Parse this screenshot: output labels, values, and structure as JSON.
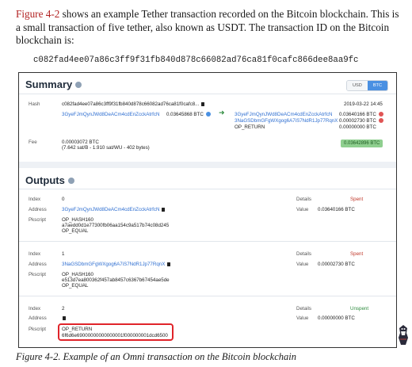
{
  "intro": {
    "xref": "Figure 4-2",
    "text": " shows an example Tether transaction recorded on the Bitcoin blockchain. This is a small transaction of five tether, also known as USDT. The transaction ID on the Bitcoin blockchain is:"
  },
  "txid": "c082fad4ee07a86c3ff9f31fb840d878c66082ad76ca81f0cafc866dee8aa9fc",
  "summary": {
    "title": "Summary",
    "toggle": [
      "USD",
      "BTC"
    ],
    "active_unit": "BTC",
    "hash_label": "Hash",
    "hash_value": "c082fad4ee07a86c3ff9f31fb840d878c66082ad76ca81f0cafc8...",
    "timestamp": "2019-03-22 14:45",
    "input": {
      "address": "3GyeFJmQynJWd8DeACm4cdEnZcckAtrfcN",
      "amount": "0.03645868 BTC"
    },
    "outputs": [
      {
        "address": "3GyeFJmQynJWd8DeACm4cdEnZcckAtrfcN",
        "amount": "0.03640166 BTC"
      },
      {
        "address": "3NaGSDbmGFgWXgog6A7iS7NdR1Jp77RqnX",
        "amount": "0.00002730 BTC"
      },
      {
        "address": "OP_RETURN",
        "amount": "0.00000000 BTC"
      }
    ],
    "fee_label": "Fee",
    "fee_value": "0.00003072 BTC",
    "fee_detail": "(7.642 sat/B - 1.910 sat/WU - 402 bytes)",
    "total": "0.03642896 BTC"
  },
  "outputs_section": {
    "title": "Outputs",
    "labels": {
      "index": "Index",
      "address": "Address",
      "pkscript": "Pkscript",
      "details": "Details",
      "value": "Value"
    },
    "items": [
      {
        "index": "0",
        "address": "3GyeFJmQynJWd8DeACm4cdEnZcckAtrfcN",
        "pkscript": [
          "OP_HASH160",
          "a7aedd0d1e77300fb06aa154c9a517b74c08d245",
          "OP_EQUAL"
        ],
        "status": "Spent",
        "value": "0.03640166 BTC"
      },
      {
        "index": "1",
        "address": "3NaGSDbmGFgWXgog6A7iS7NdR1Jp77RqnX",
        "pkscript": [
          "OP_HASH160",
          "e513d7ea800362f457ab8457c6367b67454ae5de",
          "OP_EQUAL"
        ],
        "status": "Spent",
        "value": "0.00002730 BTC"
      },
      {
        "index": "2",
        "address": "",
        "pkscript": [
          "OP_RETURN",
          "6f6d6e69000000000000001f000000001dcd6500"
        ],
        "status": "Unspent",
        "value": "0.00000000 BTC"
      }
    ]
  },
  "caption": "Figure 4-2. Example of an Omni transaction on the Bitcoin blockchain",
  "colors": {
    "link": "#2f6fd1",
    "spent": "#c0392b",
    "unspent": "#2e8b3e",
    "highlight": "#e0242a"
  }
}
